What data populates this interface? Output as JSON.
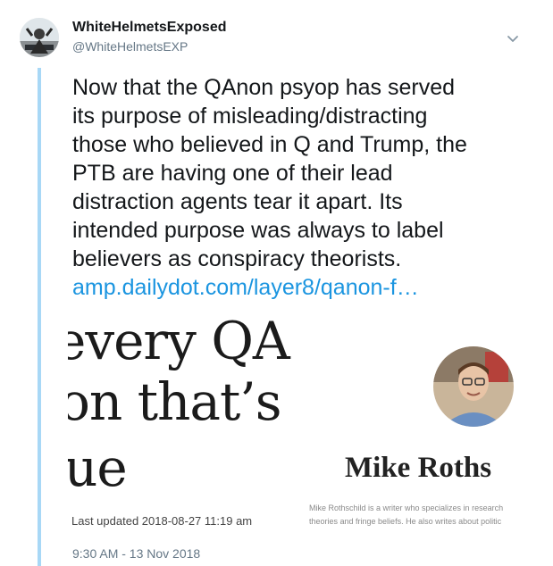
{
  "user": {
    "display_name": "WhiteHelmetsExposed",
    "handle": "@WhiteHelmetsEXP",
    "avatar_icon": "profile-photo"
  },
  "tweet": {
    "lines": [
      "Now that the QAnon psyop has served",
      "its purpose of misleading/distracting",
      "those who believed in Q and Trump, the",
      "PTB are having one of their lead",
      "distraction agents tear it apart. Its",
      "intended purpose was always to label",
      "believers as conspiracy theorists."
    ],
    "link_text": "amp.dailydot.com/layer8/qanon-f…",
    "link_color": "#1b95e0"
  },
  "card": {
    "headline_lines": [
      "every QA",
      "on that’s",
      "ue"
    ],
    "author_name": "Mike Roths",
    "author_bio_lines": [
      "Mike Rothschild is a writer who specializes in research",
      "theories and fringe beliefs. He also writes about politic"
    ],
    "last_updated": "Last updated 2018-08-27 11:19 am"
  },
  "timestamp": "9:30 AM - 13 Nov 2018",
  "menu_icon": "chevron-down-icon"
}
